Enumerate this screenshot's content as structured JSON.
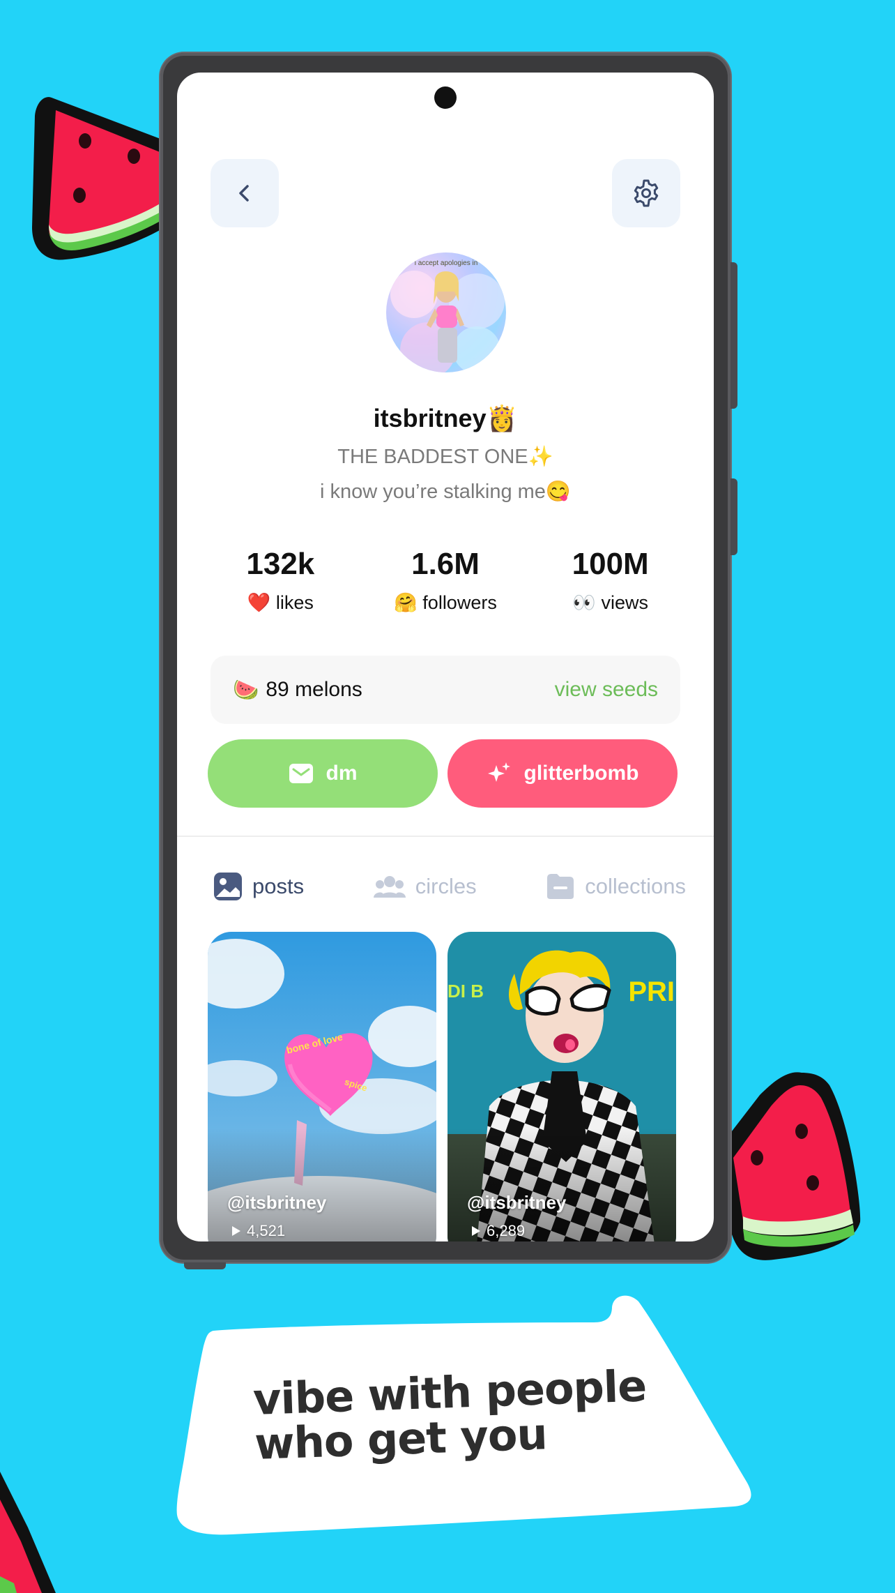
{
  "profile": {
    "username": "itsbritney",
    "username_emoji": "👸",
    "bio_line1": "THE BADDEST ONE✨",
    "bio_line2": "i know you’re stalking me😋",
    "avatar_caption": "i accept apologies in"
  },
  "stats": [
    {
      "value": "132k",
      "emoji": "❤️",
      "label": "likes"
    },
    {
      "value": "1.6M",
      "emoji": "🤗",
      "label": "followers"
    },
    {
      "value": "100M",
      "emoji": "👀",
      "label": "views"
    }
  ],
  "melons": {
    "emoji": "🍉",
    "count_label": "89 melons",
    "link_label": "view seeds"
  },
  "actions": {
    "dm_label": "dm",
    "glitterbomb_label": "glitterbomb",
    "dm_color": "#94df78",
    "glitterbomb_color": "#ff5c7c"
  },
  "tabs": [
    {
      "label": "posts",
      "icon": "image-icon",
      "active": true
    },
    {
      "label": "circles",
      "icon": "people-icon",
      "active": false
    },
    {
      "label": "collections",
      "icon": "folder-icon",
      "active": false
    }
  ],
  "posts": [
    {
      "user": "@itsbritney",
      "views": "4,521",
      "art_text_1": "bone of love",
      "art_text_2": "spice"
    },
    {
      "user": "@itsbritney",
      "views": "6,289",
      "art_text_1": "DI B",
      "art_text_2": "PRI"
    }
  ],
  "marketing": {
    "tagline_line1": "vibe with people",
    "tagline_line2": "who get you"
  },
  "colors": {
    "background": "#22d3f8",
    "accent_green": "#6cbc58",
    "tab_active": "#3b4a6b",
    "tab_inactive": "#b7bfcf"
  }
}
